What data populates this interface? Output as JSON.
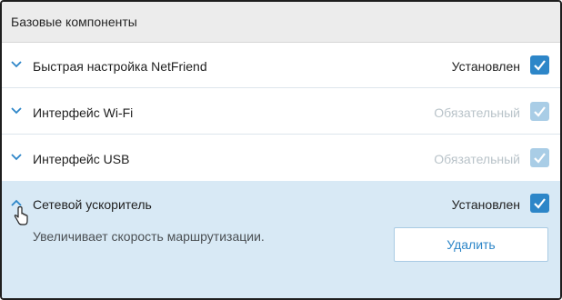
{
  "header": {
    "title": "Базовые компоненты"
  },
  "components": [
    {
      "name": "Быстрая настройка NetFriend",
      "status": "Установлен"
    },
    {
      "name": "Интерфейс Wi-Fi",
      "status": "Обязательный"
    },
    {
      "name": "Интерфейс USB",
      "status": "Обязательный"
    },
    {
      "name": "Сетевой ускоритель",
      "status": "Установлен",
      "description": "Увеличивает скорость маршрутизации.",
      "action_label": "Удалить"
    }
  ],
  "colors": {
    "accent": "#2d86c8",
    "accent_disabled": "#a9cde6",
    "expanded_background": "#d8e9f5",
    "header_background": "#ececec"
  },
  "icons": {
    "collapsed": "chevron-down-icon",
    "expanded": "chevron-up-icon",
    "checkbox": "check-icon",
    "cursor": "hand-pointer-icon"
  }
}
